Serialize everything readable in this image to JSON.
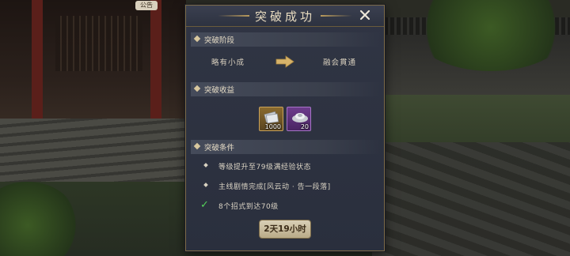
{
  "background": {
    "notice_label": "公告"
  },
  "dialog": {
    "title": "突破成功",
    "close_icon": "close-x-icon",
    "stage_section": {
      "header": "突破阶段",
      "from": "略有小成",
      "to": "融会貫通",
      "arrow_icon": "arrow-right-icon"
    },
    "reward_section": {
      "header": "突破收益",
      "items": [
        {
          "icon": "silver-notes-icon",
          "count": "1000",
          "rarity_color": "#c9a25a"
        },
        {
          "icon": "silver-ingot-icon",
          "count": "20",
          "rarity_color": "#a674c6"
        }
      ]
    },
    "condition_section": {
      "header": "突破条件",
      "items": [
        {
          "text": "等级提升至79级满经验状态",
          "met": false
        },
        {
          "text": "主线剧情完成[风云动 · 告一段落]",
          "met": false
        },
        {
          "text": "8个招式到达70级",
          "met": true
        }
      ]
    },
    "timer": "2天19小时"
  }
}
